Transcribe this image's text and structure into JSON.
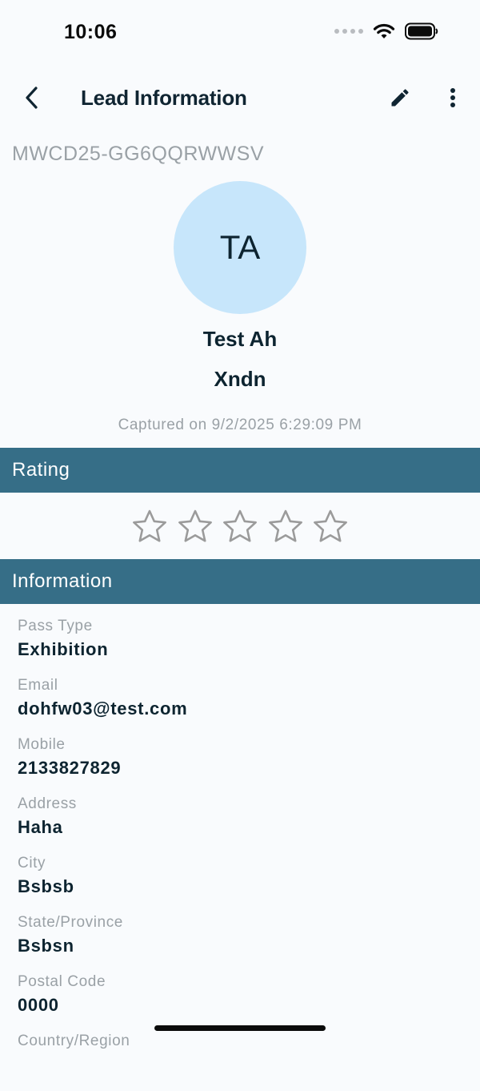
{
  "status_bar": {
    "time": "10:06"
  },
  "header": {
    "title": "Lead Information"
  },
  "lead": {
    "id": "MWCD25-GG6QQRWWSV",
    "initials": "TA",
    "name": "Test Ah",
    "company": "Xndn",
    "captured": "Captured on 9/2/2025 6:29:09 PM"
  },
  "rating": {
    "title": "Rating",
    "value": 0,
    "max": 5
  },
  "information": {
    "title": "Information",
    "items": [
      {
        "label": "Pass Type",
        "value": "Exhibition"
      },
      {
        "label": "Email",
        "value": "dohfw03@test.com"
      },
      {
        "label": "Mobile",
        "value": "2133827829"
      },
      {
        "label": "Address",
        "value": "Haha"
      },
      {
        "label": "City",
        "value": "Bsbsb"
      },
      {
        "label": "State/Province",
        "value": "Bsbsn"
      },
      {
        "label": "Postal Code",
        "value": "0000"
      },
      {
        "label": "Country/Region",
        "value": ""
      }
    ]
  },
  "colors": {
    "section_header": "#366e87",
    "avatar_bg": "#c7e6fb",
    "star_outline": "#9b9b9b"
  },
  "icons": [
    "back-icon",
    "edit-pencil-icon",
    "more-vertical-icon",
    "star-outline-icon",
    "wifi-icon",
    "battery-icon",
    "signal-icon"
  ]
}
